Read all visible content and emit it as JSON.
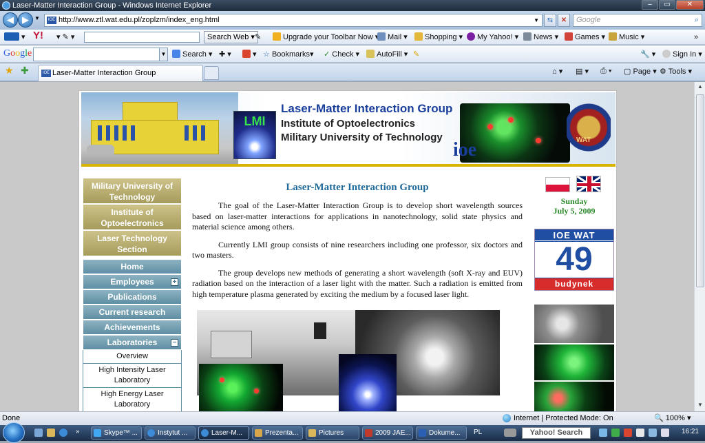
{
  "window": {
    "title": "Laser-Matter Interaction Group - Windows Internet Explorer"
  },
  "address_bar": {
    "url": "http://www.ztl.wat.edu.pl/zoplzm/index_eng.html",
    "search_placeholder": "Google"
  },
  "yahoo_toolbar": {
    "search_button": "Search Web",
    "items": [
      "Upgrade your Toolbar Now",
      "Mail",
      "Shopping",
      "My Yahoo!",
      "News",
      "Games",
      "Music"
    ]
  },
  "google_toolbar": {
    "logo": "Google",
    "items": [
      "Search",
      "Bookmarks",
      "Check",
      "AutoFill"
    ],
    "sign_in": "Sign In"
  },
  "tabs": {
    "active_label": "Laser-Matter Interaction Group",
    "commands": [
      "Page",
      "Tools"
    ]
  },
  "banner": {
    "lmi": "LMI",
    "line1": "Laser-Matter Interaction Group",
    "line2": "Institute of Optoelectronics",
    "line3": "Military University of Technology",
    "ioe": "ioe",
    "crest_text": "WAT"
  },
  "left_nav": {
    "primary": [
      "Military University of Technology",
      "Institute of Optoelectronics",
      "Laser Technology Section"
    ],
    "items": [
      {
        "label": "Home",
        "toggle": ""
      },
      {
        "label": "Employees",
        "toggle": "+"
      },
      {
        "label": "Publications",
        "toggle": ""
      },
      {
        "label": "Current research",
        "toggle": ""
      },
      {
        "label": "Achievements",
        "toggle": ""
      },
      {
        "label": "Laboratories",
        "toggle": "−"
      }
    ],
    "subitems": [
      "Overview",
      "High Intensity Laser Laboratory",
      "High Energy Laser Laboratory"
    ]
  },
  "content": {
    "heading": "Laser-Matter Interaction Group",
    "paragraphs": [
      "The goal of the Laser-Matter Interaction Group is to develop short wavelength sources based on laser-matter interactions for applications in nanotechnology, solid state physics and material science among others.",
      "Currently LMI group consists of nine researchers including one professor, six doctors and two masters.",
      "The group develops new methods of generating a short wavelength (soft X-ray and EUV) radiation based on the interaction of a laser light with the matter. Such a radiation is emitted from high temperature plasma generated by exciting the medium by a focused laser light."
    ]
  },
  "right_col": {
    "day": "Sunday",
    "date": "July 5, 2009",
    "badge_top": "IOE WAT",
    "badge_num": "49",
    "badge_bottom": "budynek"
  },
  "status_bar": {
    "left": "Done",
    "zone": "Internet | Protected Mode: On",
    "zoom": "100%"
  },
  "taskbar": {
    "buttons": [
      "Skype™ ...",
      "Instytut ...",
      "Laser-M...",
      "Prezenta...",
      "Pictures",
      "2009 JAE...",
      "Dokume..."
    ],
    "lang": "PL",
    "search": "Yahoo! Search",
    "clock": "16:21"
  }
}
